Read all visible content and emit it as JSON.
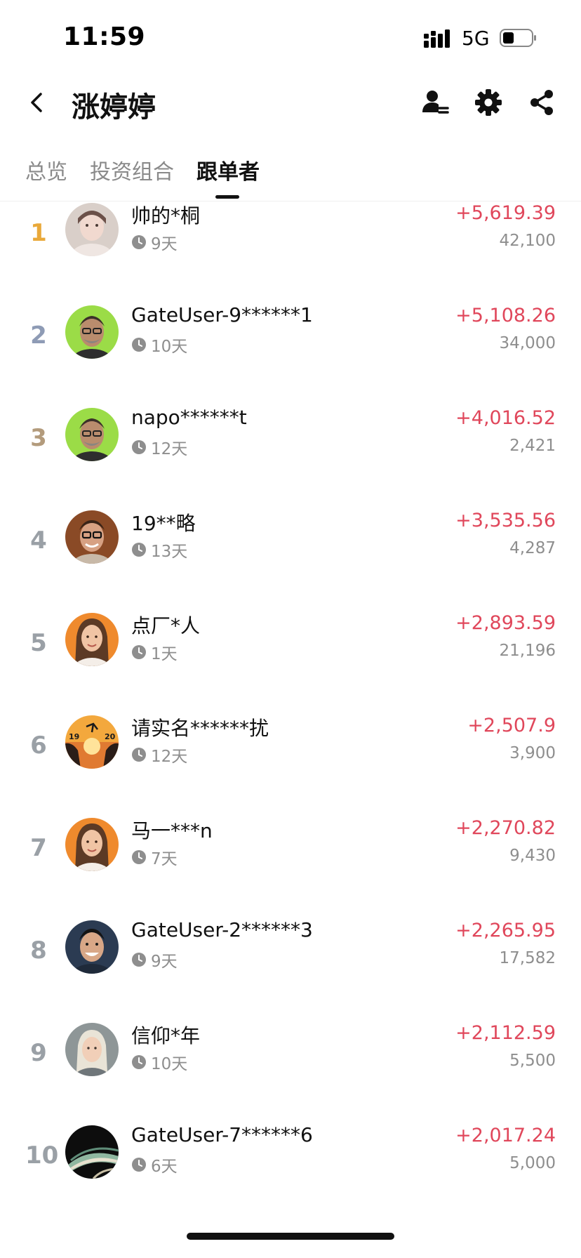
{
  "status_bar": {
    "time": "11:59",
    "network": "5G",
    "battery_level": 0.4
  },
  "header": {
    "title": "涨婷婷",
    "icons": [
      "back-icon",
      "followers-icon",
      "gear-icon",
      "share-icon"
    ]
  },
  "tabs": [
    {
      "label": "总览",
      "active": false
    },
    {
      "label": "投资组合",
      "active": false
    },
    {
      "label": "跟单者",
      "active": true
    }
  ],
  "colors": {
    "profit": "#e0475b",
    "rank_gold": "#e9a93a",
    "rank_silver": "#8e9bb5",
    "rank_bronze": "#b39b7c",
    "rank_default": "#9aa0a6"
  },
  "followers": [
    {
      "rank": "1",
      "name": "帅的*桐",
      "days": "9天",
      "pnl": "+5,619.39",
      "count": "42,100",
      "avatar": "photo-woman-light"
    },
    {
      "rank": "2",
      "name": "GateUser-9******1",
      "days": "10天",
      "pnl": "+5,108.26",
      "count": "34,000",
      "avatar": "man-glasses-green"
    },
    {
      "rank": "3",
      "name": "napo******t",
      "days": "12天",
      "pnl": "+4,016.52",
      "count": "2,421",
      "avatar": "man-glasses-green"
    },
    {
      "rank": "4",
      "name": "19**略",
      "days": "13天",
      "pnl": "+3,535.56",
      "count": "4,287",
      "avatar": "man-glasses-brown"
    },
    {
      "rank": "5",
      "name": "点厂*人",
      "days": "1天",
      "pnl": "+2,893.59",
      "count": "21,196",
      "avatar": "woman-orange"
    },
    {
      "rank": "6",
      "name": "请实名******扰",
      "days": "12天",
      "pnl": "+2,507.9",
      "count": "3,900",
      "avatar": "sunset-scene"
    },
    {
      "rank": "7",
      "name": "马一***n",
      "days": "7天",
      "pnl": "+2,270.82",
      "count": "9,430",
      "avatar": "woman-orange"
    },
    {
      "rank": "8",
      "name": "GateUser-2******3",
      "days": "9天",
      "pnl": "+2,265.95",
      "count": "17,582",
      "avatar": "man-smiling-dark"
    },
    {
      "rank": "9",
      "name": "信仰*年",
      "days": "10天",
      "pnl": "+2,112.59",
      "count": "5,500",
      "avatar": "woman-grey"
    },
    {
      "rank": "10",
      "name": "GateUser-7******6",
      "days": "6天",
      "pnl": "+2,017.24",
      "count": "5,000",
      "avatar": "agate-stone"
    }
  ]
}
